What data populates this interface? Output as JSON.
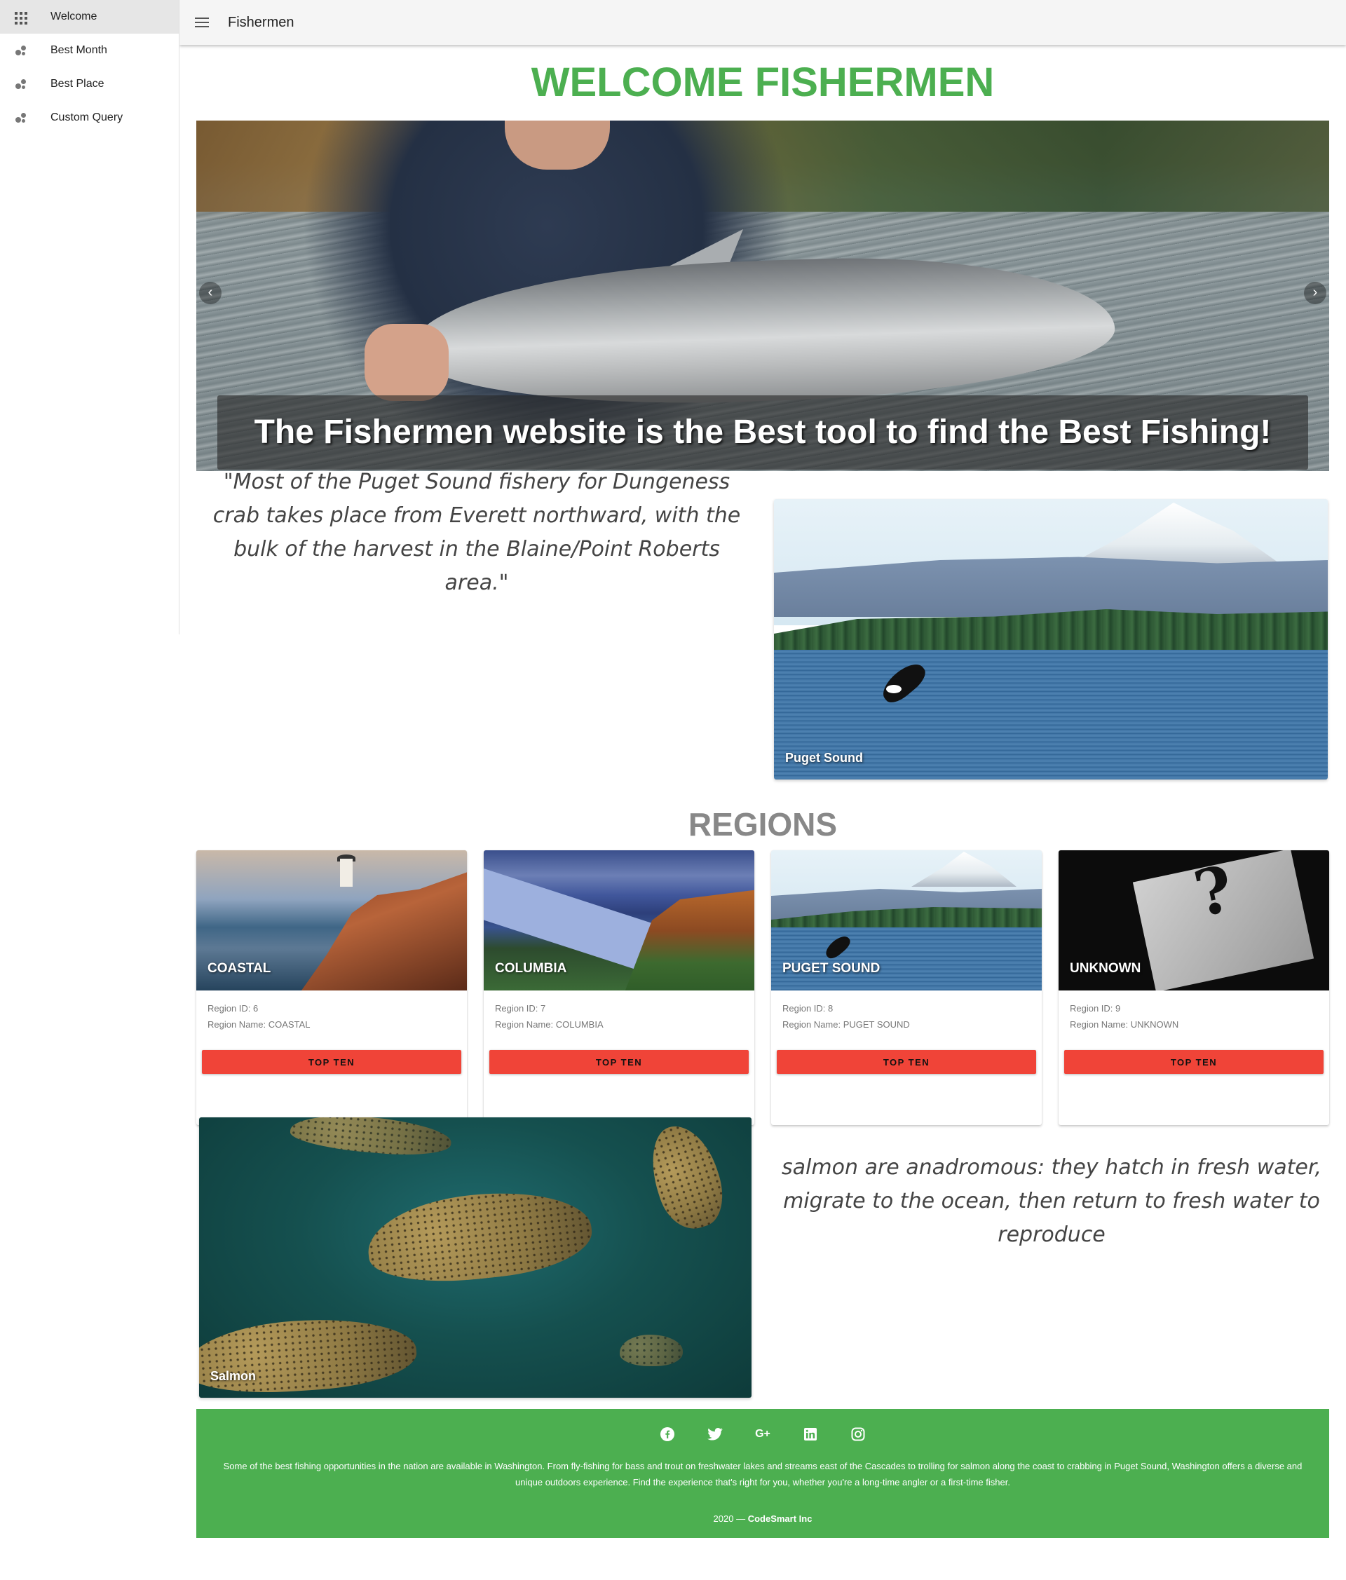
{
  "sidebar": {
    "items": [
      {
        "label": "Welcome",
        "icon": "apps-icon",
        "active": true
      },
      {
        "label": "Best Month",
        "icon": "bubble-chart-icon",
        "active": false
      },
      {
        "label": "Best Place",
        "icon": "bubble-chart-icon",
        "active": false
      },
      {
        "label": "Custom Query",
        "icon": "bubble-chart-icon",
        "active": false
      }
    ]
  },
  "appbar": {
    "menu_icon": "menu-icon",
    "title": "Fishermen"
  },
  "main": {
    "welcome_title": "WELCOME FISHERMEN",
    "hero": {
      "caption": "The Fishermen website is the Best tool to find the Best Fishing!",
      "prev_icon": "chevron-left-icon",
      "next_icon": "chevron-right-icon"
    },
    "quote_1": "\"Most of the Puget Sound fishery for Dungeness crab takes place from Everett northward, with the bulk of the harvest in the Blaine/Point Roberts area.\"",
    "puget_image_caption": "Puget Sound",
    "regions_title": "REGIONS",
    "regions": [
      {
        "name": "COASTAL",
        "id_label": "Region ID: 6",
        "name_label": "Region Name: COASTAL",
        "button": "TOP TEN"
      },
      {
        "name": "COLUMBIA",
        "id_label": "Region ID: 7",
        "name_label": "Region Name: COLUMBIA",
        "button": "TOP TEN"
      },
      {
        "name": "PUGET SOUND",
        "id_label": "Region ID: 8",
        "name_label": "Region Name: PUGET SOUND",
        "button": "TOP TEN"
      },
      {
        "name": "UNKNOWN",
        "id_label": "Region ID: 9",
        "name_label": "Region Name: UNKNOWN",
        "button": "TOP TEN"
      }
    ],
    "salmon_image_caption": "Salmon",
    "quote_2": "salmon are anadromous: they hatch in fresh water, migrate to the ocean, then return to fresh water to reproduce"
  },
  "footer": {
    "social_icons": [
      "facebook-icon",
      "twitter-icon",
      "google-plus-icon",
      "linkedin-icon",
      "instagram-icon"
    ],
    "text": "Some of the best fishing opportunities in the nation are available in Washington. From fly-fishing for bass and trout on freshwater lakes and streams east of the Cascades to trolling for salmon along the coast to crabbing in Puget Sound, Washington offers a diverse and unique outdoors experience. Find the experience that's right for you, whether you're a long-time angler or a first-time fisher.",
    "year": "2020 —",
    "company": "CodeSmart Inc"
  },
  "colors": {
    "accent_green": "#4caf50",
    "button_red": "#f04438",
    "regions_title_gray": "#888888"
  }
}
